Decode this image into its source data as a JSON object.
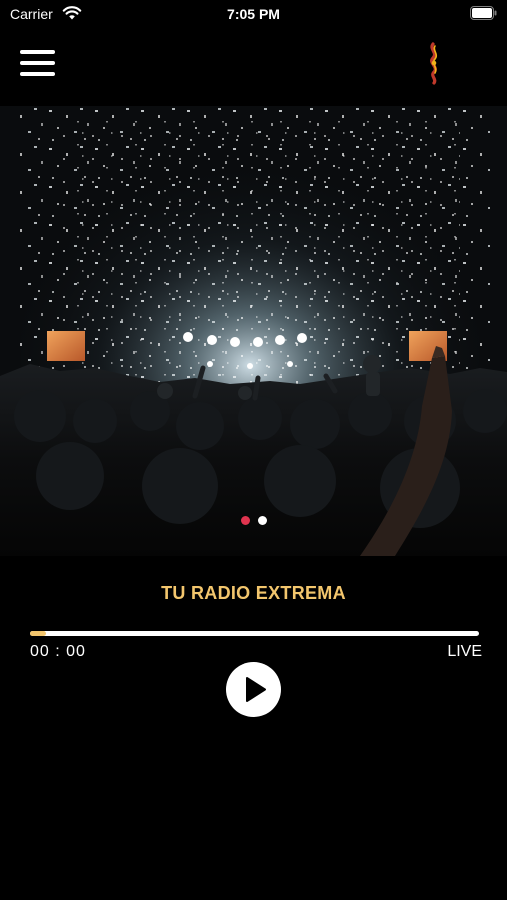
{
  "status_bar": {
    "carrier": "Carrier",
    "time": "7:05 PM"
  },
  "hero": {
    "dots": [
      {
        "active": true,
        "color": "#e0344f"
      },
      {
        "active": false,
        "color": "#ffffff"
      }
    ]
  },
  "player": {
    "station_name": "TU RADIO EXTREMA",
    "current_time": "00 : 00",
    "live_label": "LIVE",
    "progress": 0.035,
    "accent_color": "#f3c66d"
  },
  "icons": {
    "menu": "hamburger-menu-icon",
    "play": "play-icon",
    "logo": "station-logo-icon"
  }
}
